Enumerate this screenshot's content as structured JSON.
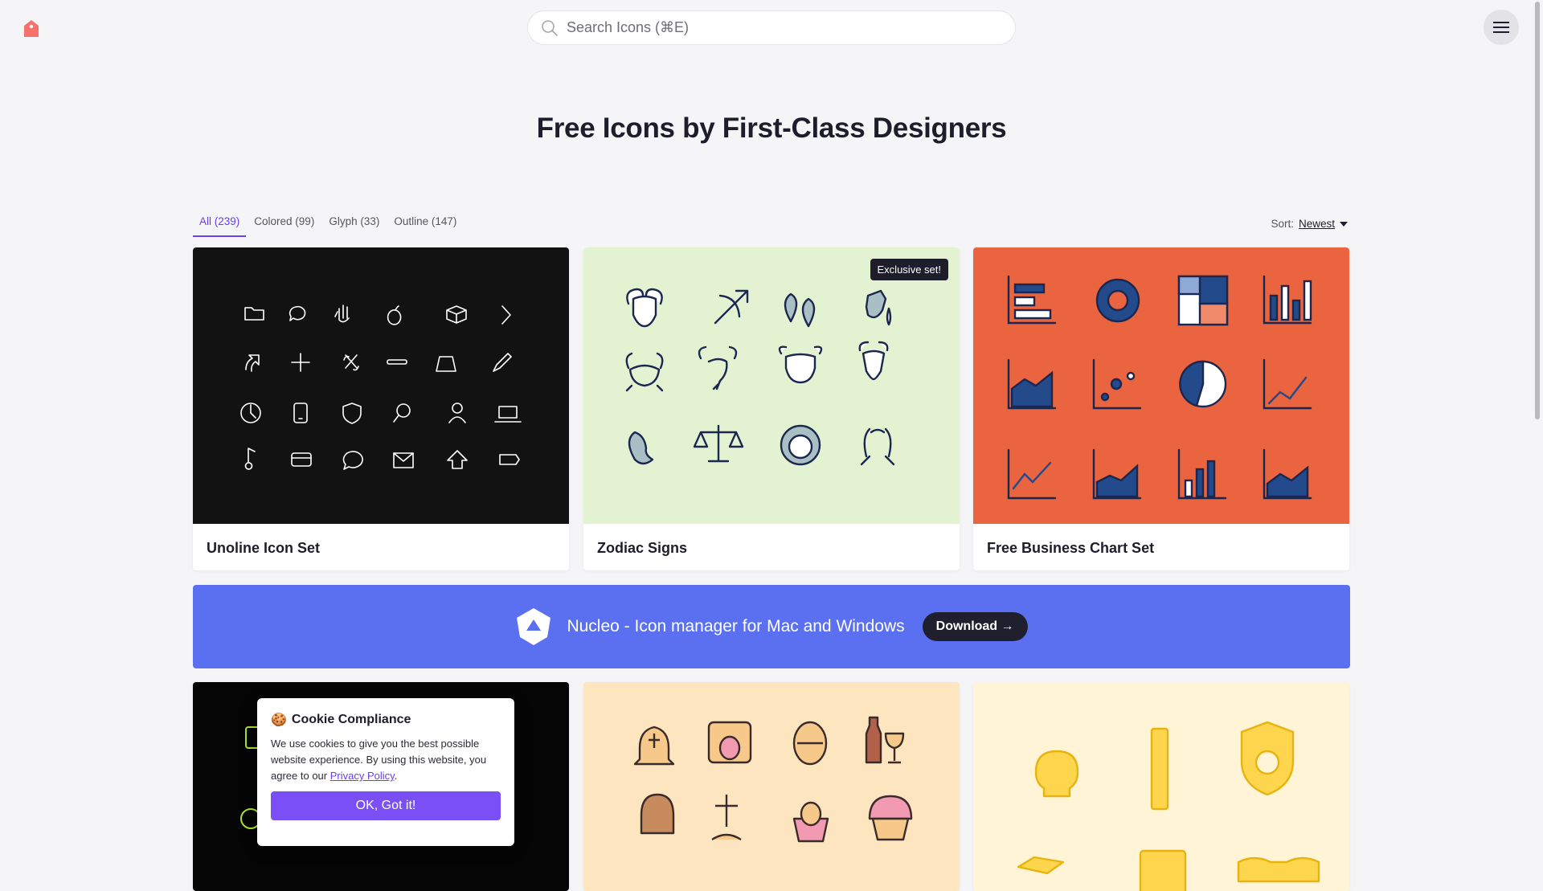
{
  "header": {
    "search_placeholder": "Search Icons (⌘E)"
  },
  "page_title": "Free Icons by First-Class Designers",
  "filters": {
    "tabs": [
      {
        "label": "All (239)"
      },
      {
        "label": "Colored (99)"
      },
      {
        "label": "Glyph (33)"
      },
      {
        "label": "Outline (147)"
      }
    ],
    "sort_label": "Sort:",
    "sort_value": "Newest"
  },
  "cards": [
    {
      "title": "Unoline Icon Set"
    },
    {
      "title": "Zodiac Signs",
      "badge": "Exclusive set!"
    },
    {
      "title": "Free Business Chart Set"
    }
  ],
  "banner": {
    "text": "Nucleo - Icon manager for Mac and Windows",
    "button": "Download →"
  },
  "cookie": {
    "emoji": "🍪",
    "title": "Cookie Compliance",
    "body": "We use cookies to give you the best possible website experience. By using this website, you agree to our",
    "link": "Privacy Policy",
    "button": "OK, Got it!"
  },
  "colors": {
    "accent": "#6b3ff0",
    "banner": "#5b70f0",
    "zodiac_bg": "#e3f3d2",
    "business_bg": "#e9643f",
    "easter_bg": "#fde6bf",
    "yellow_bg": "#fff5d6"
  }
}
